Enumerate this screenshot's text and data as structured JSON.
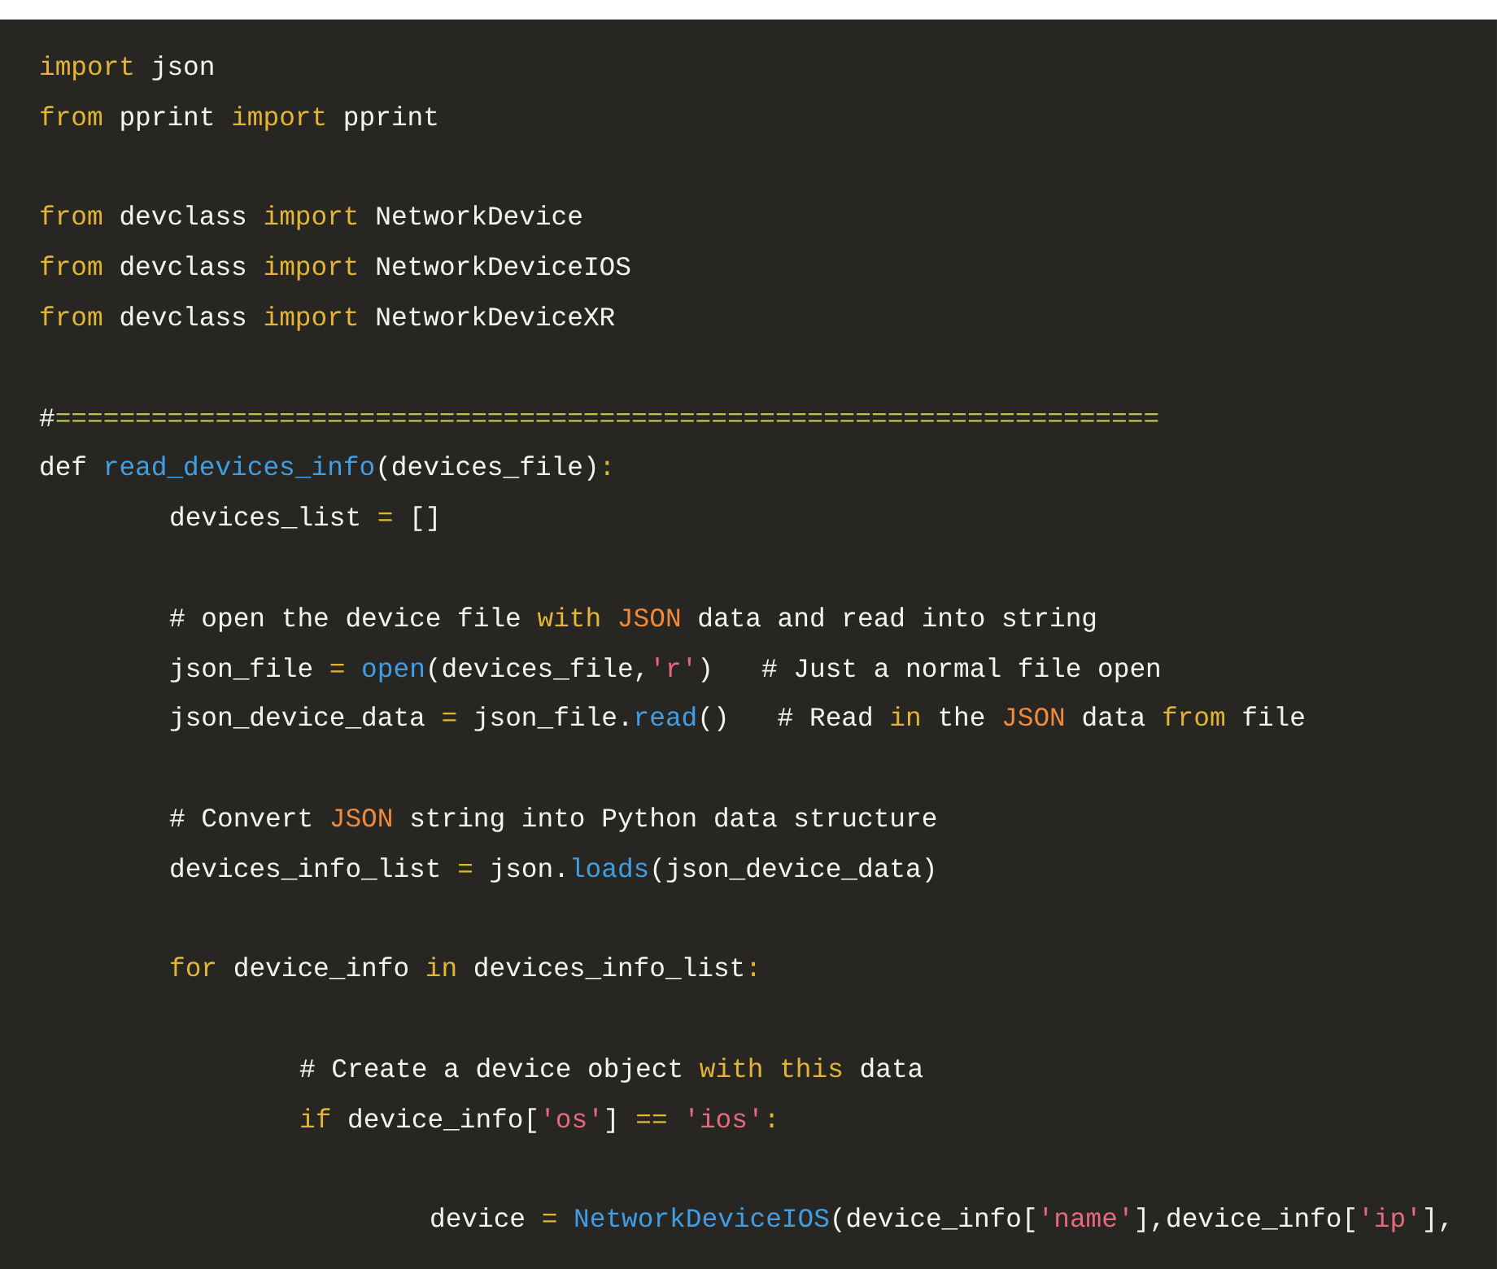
{
  "code_block": {
    "lines": [
      {
        "kind": "code",
        "tokens": [
          {
            "t": "import",
            "kind": "keyword"
          },
          {
            "t": " json",
            "kind": "plain"
          }
        ]
      },
      {
        "kind": "code",
        "tokens": [
          {
            "t": "from",
            "kind": "keyword"
          },
          {
            "t": " pprint ",
            "kind": "plain"
          },
          {
            "t": "import",
            "kind": "keyword"
          },
          {
            "t": " pprint",
            "kind": "plain"
          }
        ]
      },
      {
        "kind": "blank"
      },
      {
        "kind": "code",
        "tokens": [
          {
            "t": "from",
            "kind": "keyword"
          },
          {
            "t": " devclass ",
            "kind": "plain"
          },
          {
            "t": "import",
            "kind": "keyword"
          },
          {
            "t": " NetworkDevice",
            "kind": "plain"
          }
        ]
      },
      {
        "kind": "code",
        "tokens": [
          {
            "t": "from",
            "kind": "keyword"
          },
          {
            "t": " devclass ",
            "kind": "plain"
          },
          {
            "t": "import",
            "kind": "keyword"
          },
          {
            "t": " NetworkDeviceIOS",
            "kind": "plain"
          }
        ]
      },
      {
        "kind": "code",
        "tokens": [
          {
            "t": "from",
            "kind": "keyword"
          },
          {
            "t": " devclass ",
            "kind": "plain"
          },
          {
            "t": "import",
            "kind": "keyword"
          },
          {
            "t": " NetworkDeviceXR",
            "kind": "plain"
          }
        ]
      },
      {
        "kind": "blank"
      },
      {
        "kind": "code",
        "tokens": [
          {
            "t": "#",
            "kind": "plain"
          },
          {
            "t": "=====================================================================",
            "kind": "rule"
          }
        ]
      },
      {
        "kind": "code",
        "tokens": [
          {
            "t": "def ",
            "kind": "plain"
          },
          {
            "t": "read_devices_info",
            "kind": "function"
          },
          {
            "t": "(devices_file)",
            "kind": "plain"
          },
          {
            "t": ":",
            "kind": "keyword"
          }
        ],
        "children": [
          {
            "kind": "code",
            "tokens": [
              {
                "t": "devices_list ",
                "kind": "plain"
              },
              {
                "t": "=",
                "kind": "keyword"
              },
              {
                "t": " []",
                "kind": "plain"
              }
            ]
          },
          {
            "kind": "blank"
          },
          {
            "kind": "code",
            "tokens": [
              {
                "t": "# open the device file ",
                "kind": "plain"
              },
              {
                "t": "with",
                "kind": "keyword"
              },
              {
                "t": " JSON",
                "kind": "constant"
              },
              {
                "t": " data and read into string",
                "kind": "plain"
              }
            ]
          },
          {
            "kind": "code",
            "tokens": [
              {
                "t": "json_file ",
                "kind": "plain"
              },
              {
                "t": "=",
                "kind": "keyword"
              },
              {
                "t": " open",
                "kind": "function"
              },
              {
                "t": "(devices_file,",
                "kind": "plain"
              },
              {
                "t": "'r'",
                "kind": "string"
              },
              {
                "t": ")   # Just a normal file open",
                "kind": "plain"
              }
            ]
          },
          {
            "kind": "code",
            "tokens": [
              {
                "t": "json_device_data ",
                "kind": "plain"
              },
              {
                "t": "=",
                "kind": "keyword"
              },
              {
                "t": " json_file.",
                "kind": "plain"
              },
              {
                "t": "read",
                "kind": "function"
              },
              {
                "t": "()   # Read ",
                "kind": "plain"
              },
              {
                "t": "in",
                "kind": "keyword"
              },
              {
                "t": " the ",
                "kind": "plain"
              },
              {
                "t": "JSON",
                "kind": "constant"
              },
              {
                "t": " data ",
                "kind": "plain"
              },
              {
                "t": "from",
                "kind": "keyword"
              },
              {
                "t": " file",
                "kind": "plain"
              }
            ]
          },
          {
            "kind": "blank"
          },
          {
            "kind": "code",
            "tokens": [
              {
                "t": "# Convert ",
                "kind": "plain"
              },
              {
                "t": "JSON",
                "kind": "constant"
              },
              {
                "t": " string into Python data structure",
                "kind": "plain"
              }
            ]
          },
          {
            "kind": "code",
            "tokens": [
              {
                "t": "devices_info_list ",
                "kind": "plain"
              },
              {
                "t": "=",
                "kind": "keyword"
              },
              {
                "t": " json.",
                "kind": "plain"
              },
              {
                "t": "loads",
                "kind": "function"
              },
              {
                "t": "(json_device_data)",
                "kind": "plain"
              }
            ]
          },
          {
            "kind": "blank"
          },
          {
            "kind": "code",
            "tokens": [
              {
                "t": "for",
                "kind": "keyword"
              },
              {
                "t": " device_info ",
                "kind": "plain"
              },
              {
                "t": "in",
                "kind": "keyword"
              },
              {
                "t": " devices_info_list",
                "kind": "plain"
              },
              {
                "t": ":",
                "kind": "keyword"
              }
            ],
            "children": [
              {
                "kind": "blank"
              },
              {
                "kind": "code",
                "tokens": [
                  {
                    "t": "# Create a device object ",
                    "kind": "plain"
                  },
                  {
                    "t": "with this",
                    "kind": "keyword"
                  },
                  {
                    "t": " data",
                    "kind": "plain"
                  }
                ]
              },
              {
                "kind": "code",
                "tokens": [
                  {
                    "t": "if",
                    "kind": "keyword"
                  },
                  {
                    "t": " device_info[",
                    "kind": "plain"
                  },
                  {
                    "t": "'os'",
                    "kind": "string"
                  },
                  {
                    "t": "] ",
                    "kind": "plain"
                  },
                  {
                    "t": "==",
                    "kind": "keyword"
                  },
                  {
                    "t": " 'ios'",
                    "kind": "string"
                  },
                  {
                    "t": ":",
                    "kind": "keyword"
                  }
                ],
                "children": [
                  {
                    "kind": "blank"
                  },
                  {
                    "kind": "code",
                    "tokens": [
                      {
                        "t": "device ",
                        "kind": "plain"
                      },
                      {
                        "t": "=",
                        "kind": "keyword"
                      },
                      {
                        "t": " NetworkDeviceIOS",
                        "kind": "function"
                      },
                      {
                        "t": "(device_info[",
                        "kind": "plain"
                      },
                      {
                        "t": "'name'",
                        "kind": "string"
                      },
                      {
                        "t": "],device_info[",
                        "kind": "plain"
                      },
                      {
                        "t": "'ip'",
                        "kind": "string"
                      },
                      {
                        "t": "],",
                        "kind": "plain"
                      }
                    ]
                  }
                ]
              }
            ]
          }
        ]
      }
    ]
  }
}
